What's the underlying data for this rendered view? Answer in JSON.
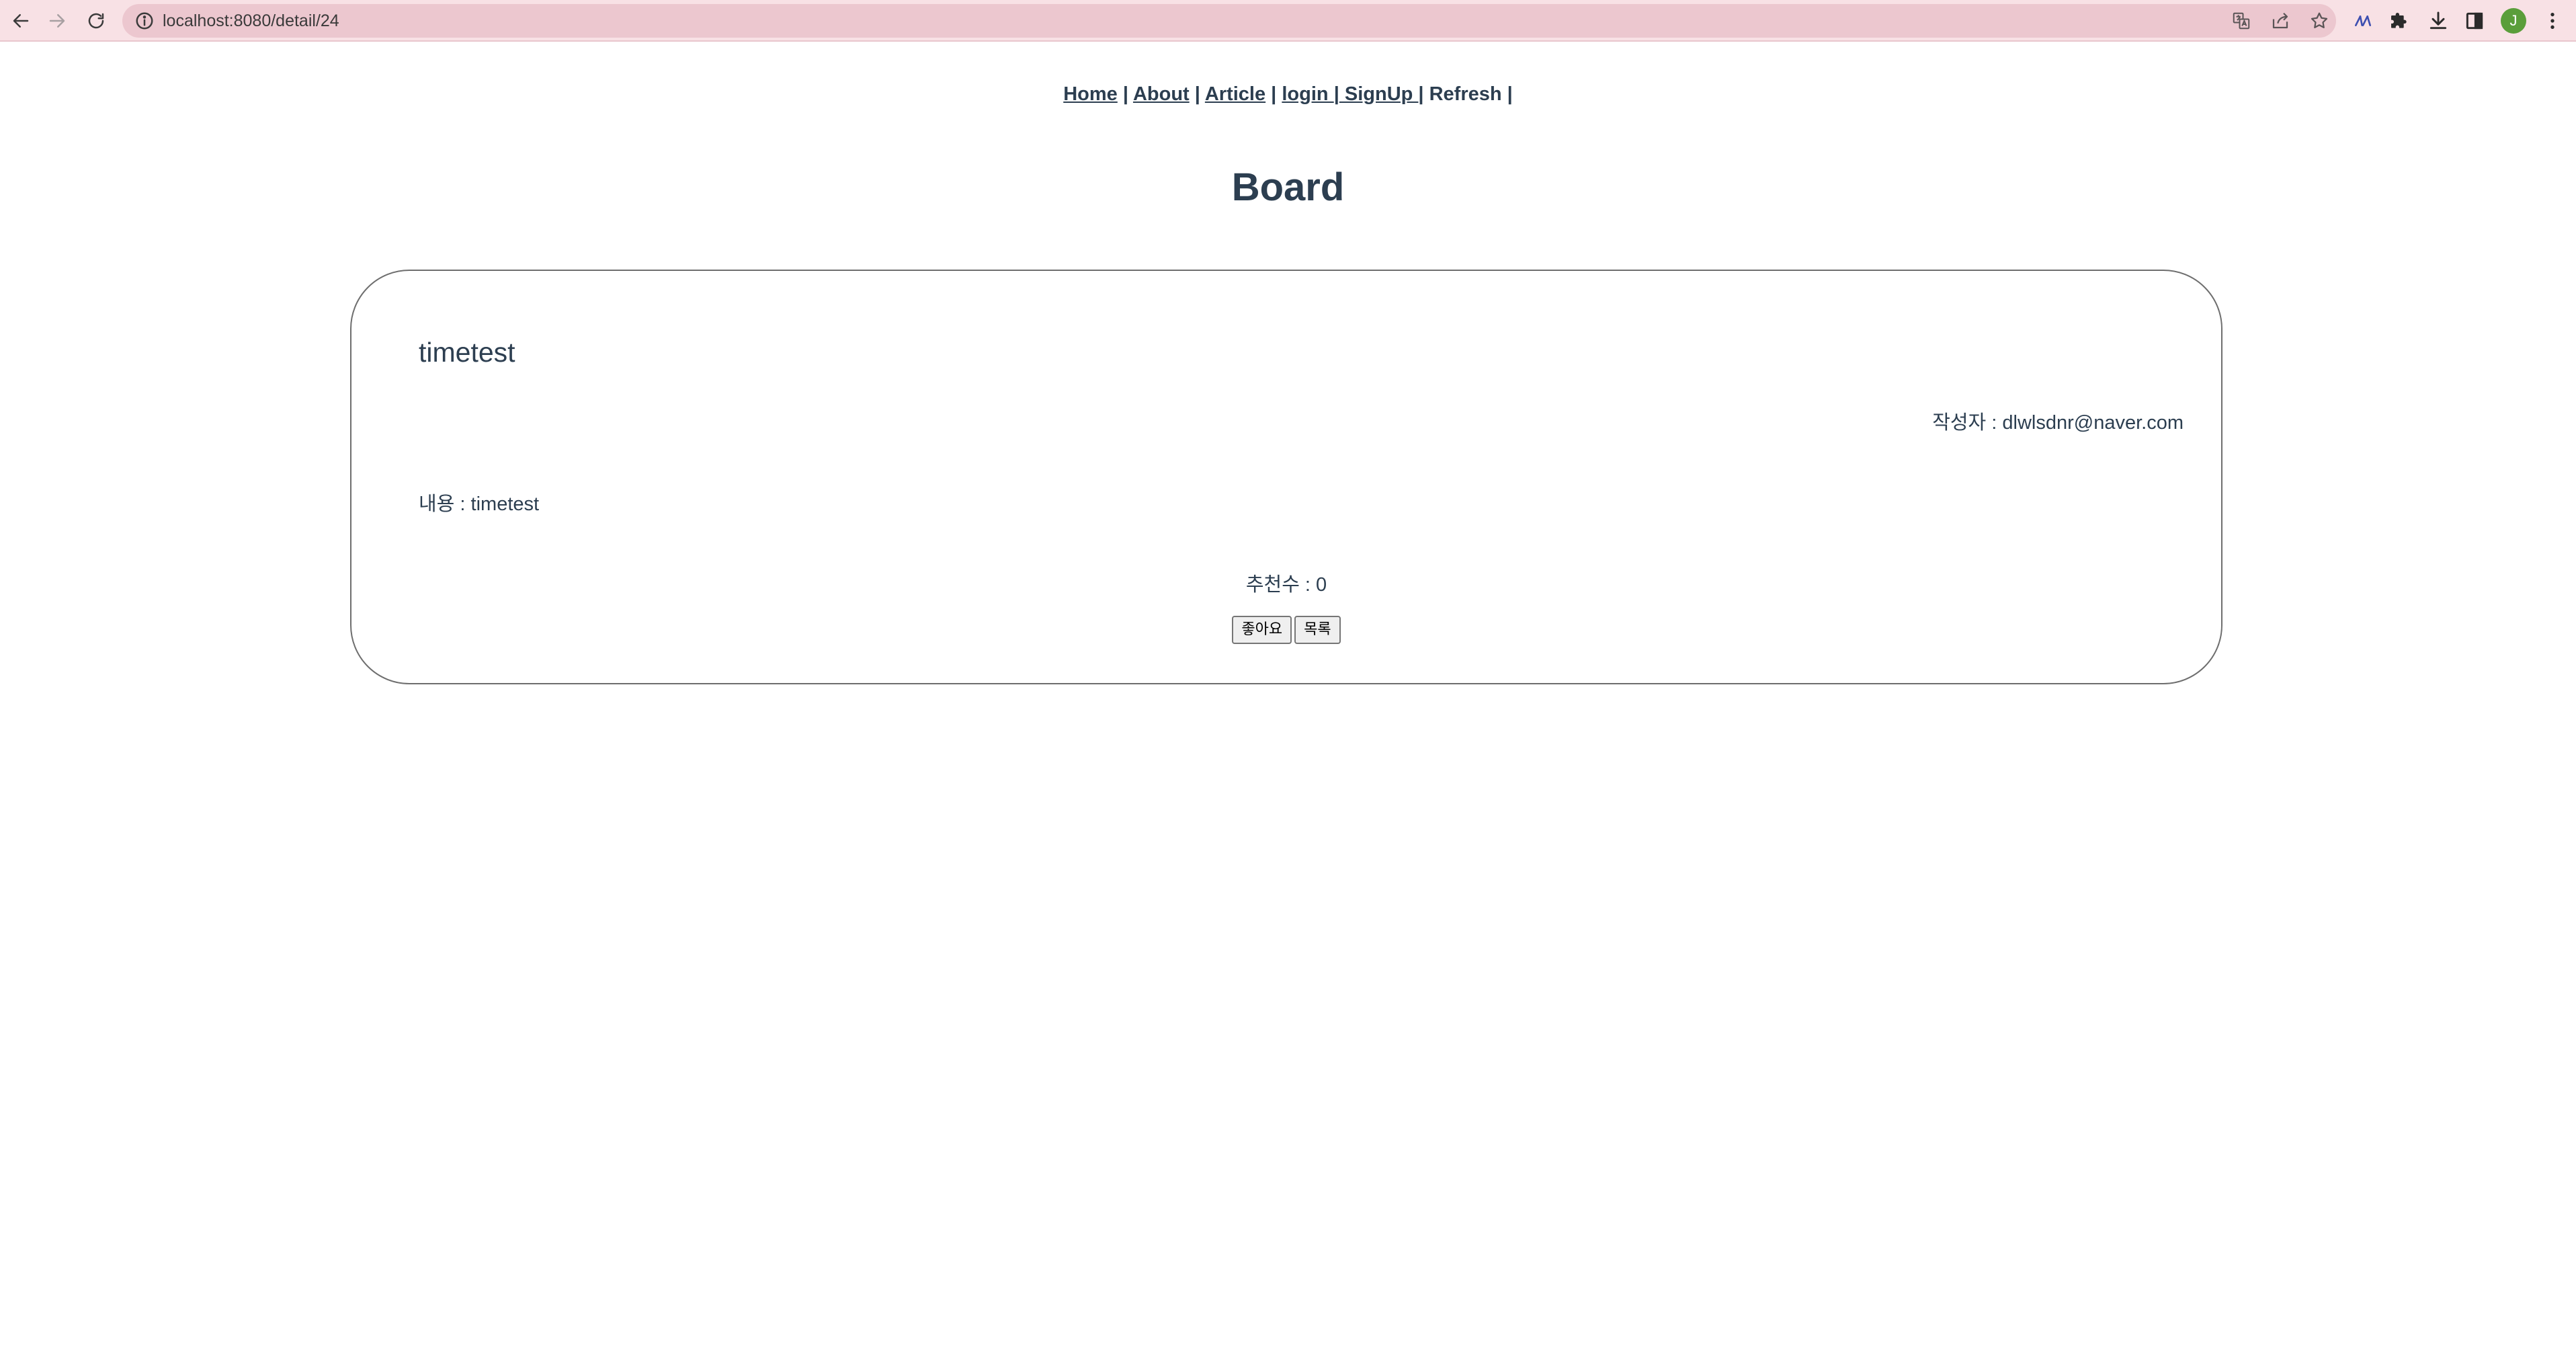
{
  "browser": {
    "url": "localhost:8080/detail/24",
    "profile_initial": "J",
    "colors": {
      "toolbar": "#f8e1e5",
      "omnibox": "#ecc7cf",
      "avatar": "#5a9e3a"
    }
  },
  "nav": {
    "home": "Home",
    "about": "About",
    "article": "Article",
    "login": "login ",
    "signup": " SignUp ",
    "refresh": "Refresh",
    "separator": " | "
  },
  "page": {
    "title": "Board"
  },
  "post": {
    "title": "timetest",
    "author_label": "작성자 : dlwlsdnr@naver.com",
    "content_label": "내용 : timetest",
    "likes_label": "추천수 : 0",
    "like_button": "좋아요",
    "list_button": "목록"
  },
  "colors": {
    "text": "#2c3e50",
    "card_border": "#6e6e6e"
  }
}
